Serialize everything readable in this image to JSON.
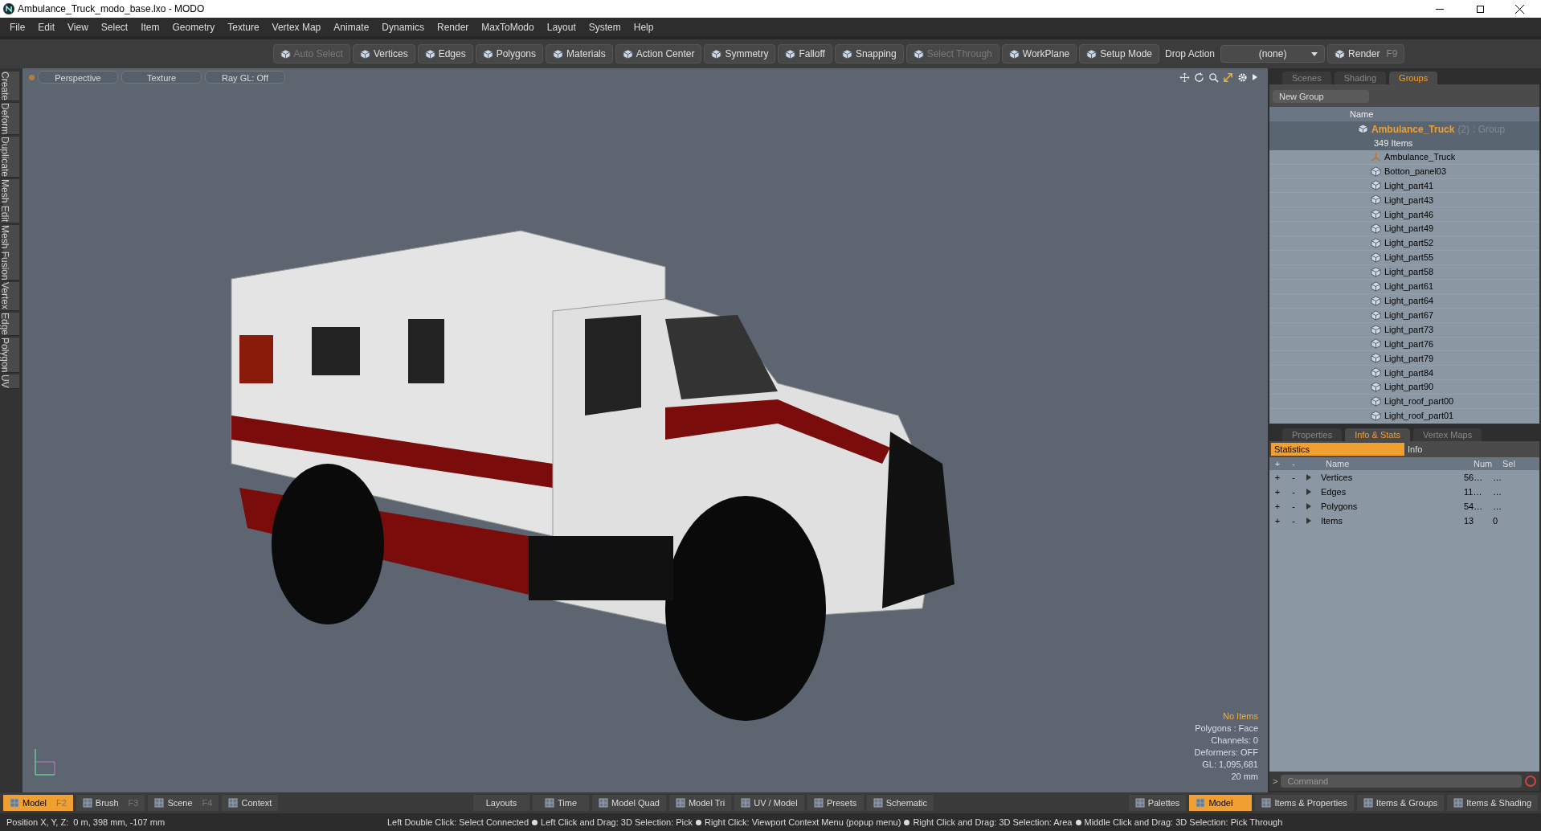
{
  "window": {
    "title": "Ambulance_Truck_modo_base.lxo - MODO"
  },
  "menu": [
    "File",
    "Edit",
    "View",
    "Select",
    "Item",
    "Geometry",
    "Texture",
    "Vertex Map",
    "Animate",
    "Dynamics",
    "Render",
    "MaxToModo",
    "Layout",
    "System",
    "Help"
  ],
  "toolbar": [
    {
      "kind": "button",
      "label": "Auto Select",
      "disabled": true
    },
    {
      "kind": "button",
      "label": "Vertices",
      "disabled": false
    },
    {
      "kind": "button",
      "label": "Edges",
      "disabled": false
    },
    {
      "kind": "button",
      "label": "Polygons",
      "disabled": false
    },
    {
      "kind": "button",
      "label": "Materials",
      "disabled": false
    },
    {
      "kind": "button",
      "label": "Action Center",
      "disabled": false
    },
    {
      "kind": "button",
      "label": "Symmetry",
      "disabled": false
    },
    {
      "kind": "button",
      "label": "Falloff",
      "disabled": false
    },
    {
      "kind": "button",
      "label": "Snapping",
      "disabled": false
    },
    {
      "kind": "button",
      "label": "Select Through",
      "disabled": true
    },
    {
      "kind": "button",
      "label": "WorkPlane",
      "disabled": false
    },
    {
      "kind": "button",
      "label": "Setup Mode",
      "disabled": false
    },
    {
      "kind": "label",
      "label": "Drop Action"
    },
    {
      "kind": "dropdown",
      "label": "(none)"
    },
    {
      "kind": "button",
      "label": "Render",
      "shortcut": "F9",
      "disabled": false
    }
  ],
  "left_tabs": [
    "Create",
    "Deform",
    "Duplicate",
    "Mesh Edit",
    "Mesh Fusion",
    "Vertex",
    "Edge",
    "Polygon",
    "UV"
  ],
  "viewport": {
    "tabs": [
      "Perspective",
      "Texture",
      "Ray GL: Off"
    ],
    "stats": [
      {
        "text": "No Items",
        "kind": "highlight"
      },
      {
        "text": "Polygons : Face",
        "kind": "normal"
      },
      {
        "text": "Channels: 0",
        "kind": "normal"
      },
      {
        "text": "Deformers: OFF",
        "kind": "normal"
      },
      {
        "text": "GL: 1,095,681",
        "kind": "normal"
      },
      {
        "text": "20 mm",
        "kind": "normal"
      }
    ]
  },
  "groups_panel": {
    "tabs": [
      {
        "label": "Scenes",
        "selected": false
      },
      {
        "label": "Shading",
        "selected": false
      },
      {
        "label": "Groups",
        "selected": true
      }
    ],
    "new_group": "New Group",
    "name_column": "Name",
    "group": {
      "name": "Ambulance_Truck",
      "count": "(2)",
      "type": ": Group",
      "items": "349 Items",
      "children": [
        {
          "name": "Ambulance_Truck",
          "kind": "locator"
        },
        {
          "name": "Botton_panel03",
          "kind": "mesh"
        },
        {
          "name": "Light_part41",
          "kind": "mesh"
        },
        {
          "name": "Light_part43",
          "kind": "mesh"
        },
        {
          "name": "Light_part46",
          "kind": "mesh"
        },
        {
          "name": "Light_part49",
          "kind": "mesh"
        },
        {
          "name": "Light_part52",
          "kind": "mesh"
        },
        {
          "name": "Light_part55",
          "kind": "mesh"
        },
        {
          "name": "Light_part58",
          "kind": "mesh"
        },
        {
          "name": "Light_part61",
          "kind": "mesh"
        },
        {
          "name": "Light_part64",
          "kind": "mesh"
        },
        {
          "name": "Light_part67",
          "kind": "mesh"
        },
        {
          "name": "Light_part73",
          "kind": "mesh"
        },
        {
          "name": "Light_part76",
          "kind": "mesh"
        },
        {
          "name": "Light_part79",
          "kind": "mesh"
        },
        {
          "name": "Light_part84",
          "kind": "mesh"
        },
        {
          "name": "Light_part90",
          "kind": "mesh"
        },
        {
          "name": "Light_roof_part00",
          "kind": "mesh"
        },
        {
          "name": "Light_roof_part01",
          "kind": "mesh"
        }
      ]
    }
  },
  "stats_panel": {
    "tabs": [
      {
        "label": "Properties",
        "selected": false
      },
      {
        "label": "Info & Stats",
        "selected": true
      },
      {
        "label": "Vertex Maps",
        "selected": false
      }
    ],
    "subtabs": [
      {
        "label": "Statistics",
        "selected": true
      },
      {
        "label": "Info",
        "selected": false
      }
    ],
    "columns": [
      "+",
      "-",
      "Name",
      "Num",
      "Sel"
    ],
    "rows": [
      {
        "plus": "+",
        "minus": "-",
        "name": "Vertices",
        "num": "56…",
        "sel": "…"
      },
      {
        "plus": "+",
        "minus": "-",
        "name": "Edges",
        "num": "11…",
        "sel": "…"
      },
      {
        "plus": "+",
        "minus": "-",
        "name": "Polygons",
        "num": "54…",
        "sel": "…"
      },
      {
        "plus": "+",
        "minus": "-",
        "name": "Items",
        "num": "13",
        "sel": "0"
      }
    ],
    "command_placeholder": "Command",
    "prompt": ">"
  },
  "bottom_bar": {
    "left": [
      {
        "label": "Model",
        "shortcut": "F2",
        "selected": true
      },
      {
        "label": "Brush",
        "shortcut": "F3",
        "selected": false
      },
      {
        "label": "Scene",
        "shortcut": "F4",
        "selected": false
      },
      {
        "label": "Context",
        "selected": false
      }
    ],
    "center": [
      {
        "label": "Layouts",
        "kind": "plain"
      },
      {
        "label": "Time",
        "kind": "layout"
      },
      {
        "label": "Model Quad",
        "kind": "layout"
      },
      {
        "label": "Model Tri",
        "kind": "layout"
      },
      {
        "label": "UV / Model",
        "kind": "layout"
      },
      {
        "label": "Presets",
        "kind": "layout"
      },
      {
        "label": "Schematic",
        "kind": "layout"
      }
    ],
    "right": [
      {
        "label": "Palettes",
        "selected": false
      },
      {
        "label": "Model",
        "selected": true
      },
      {
        "label": "Items & Properties",
        "selected": false
      },
      {
        "label": "Items & Groups",
        "selected": false
      },
      {
        "label": "Items & Shading",
        "selected": false
      }
    ]
  },
  "status_bar": {
    "position": "Position X, Y, Z:  0 m, 398 mm, -107 mm",
    "hints": [
      "Left Double Click: Select Connected",
      "Left Click and Drag: 3D Selection: Pick",
      "Right Click: Viewport Context Menu (popup menu)",
      "Right Click and Drag: 3D Selection: Area",
      "Middle Click and Drag: 3D Selection: Pick Through"
    ]
  }
}
